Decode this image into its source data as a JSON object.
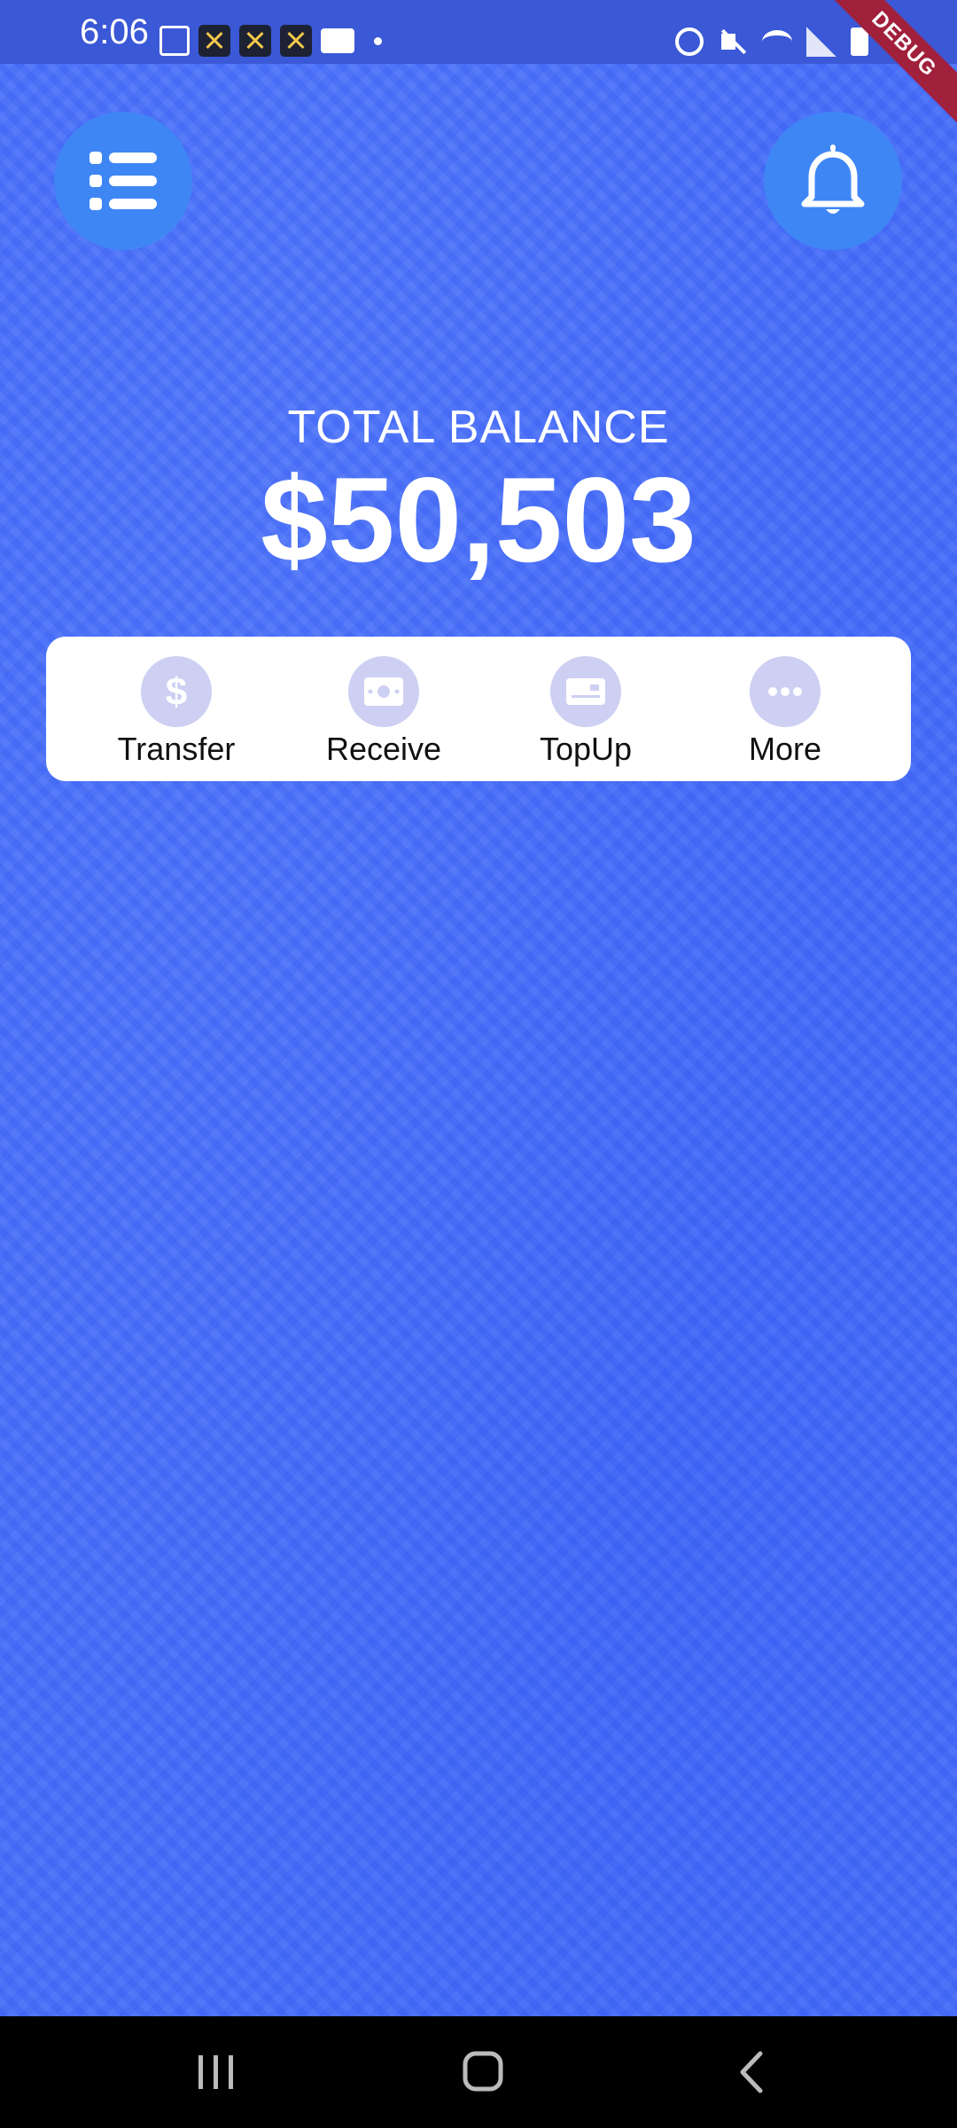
{
  "status_bar": {
    "time": "6:06",
    "debug_label": "DEBUG"
  },
  "header": {
    "menu_icon": "menu-list-icon",
    "notification_icon": "bell-icon"
  },
  "balance": {
    "label": "TOTAL BALANCE",
    "amount": "$50,503"
  },
  "actions": [
    {
      "label": "Transfer",
      "icon": "dollar-icon"
    },
    {
      "label": "Receive",
      "icon": "cash-icon"
    },
    {
      "label": "TopUp",
      "icon": "card-icon"
    },
    {
      "label": "More",
      "icon": "more-dots-icon"
    }
  ],
  "colors": {
    "background": "#4f74f7",
    "button": "#3f86f5",
    "action_icon_bg": "#cdd0f2",
    "debug_ribbon": "#a1203c"
  }
}
